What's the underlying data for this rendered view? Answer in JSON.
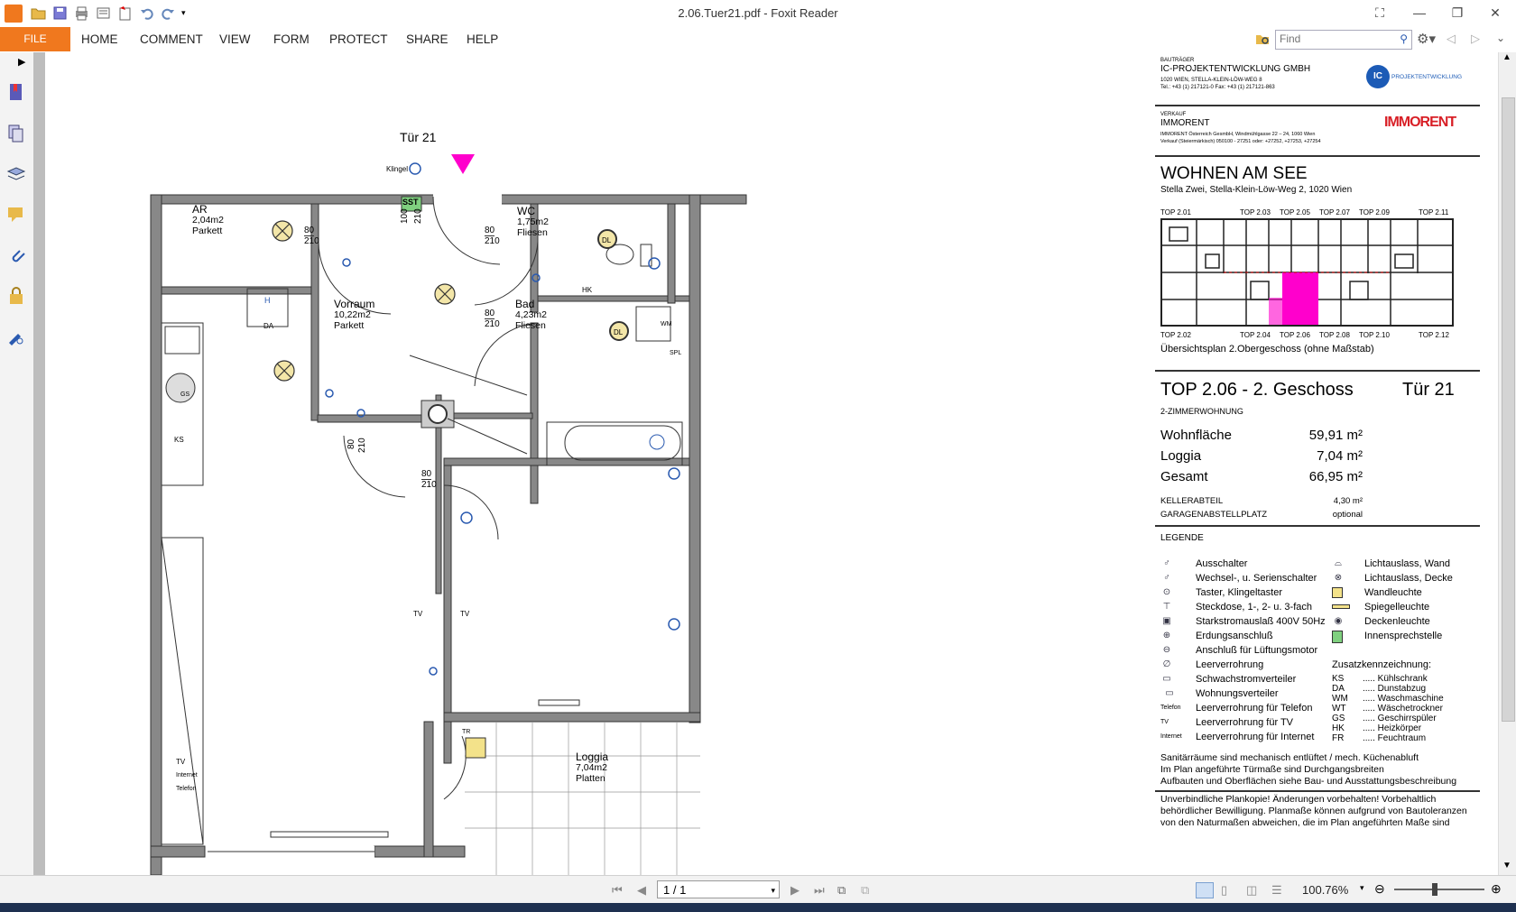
{
  "app": {
    "window_title": "2.06.Tuer21.pdf - Foxit Reader",
    "menu": {
      "file": "FILE",
      "items": [
        "HOME",
        "COMMENT",
        "VIEW",
        "FORM",
        "PROTECT",
        "SHARE",
        "HELP"
      ]
    },
    "find_placeholder": "Find",
    "page_field": "1 / 1",
    "zoom": "100.76%",
    "colors": {
      "file_tab": "#f0781e",
      "highlight": "#ff00cc"
    }
  },
  "plan": {
    "door_label": "Tür 21",
    "bell": "Klingel",
    "rooms": [
      {
        "name": "AR",
        "area": "2,04m2",
        "floor": "Parkett"
      },
      {
        "name": "WC",
        "area": "1,75m2",
        "floor": "Fliesen"
      },
      {
        "name": "Vorraum",
        "area": "10,22m2",
        "floor": "Parkett"
      },
      {
        "name": "Bad",
        "area": "4,23m2",
        "floor": "Fliesen"
      },
      {
        "name": "Loggia",
        "area": "7,04m2",
        "floor": "Platten"
      }
    ],
    "door_sizes": [
      "80",
      "210",
      "100",
      "210"
    ],
    "fixtures": {
      "sst": "SST",
      "dl": "DL",
      "h": "H",
      "da": "DA",
      "ks": "KS",
      "hk": "HK",
      "wm": "WM",
      "sp": "SPL",
      "tr": "TR",
      "gs": "GS"
    },
    "outlets": {
      "tv": "TV",
      "internet": "Internet",
      "telefon": "Telefon"
    }
  },
  "sheet": {
    "developer_label": "BAUTRÄGER",
    "developer": "IC-PROJEKTENTWICKLUNG GMBH",
    "developer_address": "1020 WIEN, STELLA-KLEIN-LÖW-WEG 8",
    "developer_phone": "Tel.: +43 (1) 217121-0  Fax: +43 (1) 217121-863",
    "developer_logo": "IC",
    "developer_logo_text": "PROJEKTENTWICKLUNG",
    "sales_label": "VERKAUF",
    "sales": "IMMORENT",
    "sales_address": "IMMORENT Österreich GesmbH, Windmühlgasse 22 – 24, 1060 Wien",
    "sales_phone": "Verkauf (Steiermärkisch) 050100 - 27251 oder: +27252, +27253, +27254",
    "sales_logo": "IMMORENT",
    "project": "WOHNEN AM SEE",
    "project_address": "Stella Zwei, Stella-Klein-Löw-Weg 2, 1020 Wien",
    "overview_top": [
      "TOP 2.01",
      "TOP 2.03",
      "TOP 2.05",
      "TOP 2.07",
      "TOP 2.09",
      "TOP 2.11"
    ],
    "overview_bottom": [
      "TOP 2.02",
      "TOP 2.04",
      "TOP 2.06",
      "TOP 2.08",
      "TOP 2.10",
      "TOP 2.12"
    ],
    "overview_caption": "Übersichtsplan 2.Obergeschoss (ohne Maßstab)",
    "unit_title": "TOP 2.06 - 2. Geschoss",
    "unit_door": "Tür 21",
    "unit_type": "2-ZIMMERWOHNUNG",
    "areas": [
      {
        "label": "Wohnfläche",
        "value": "59,91 m²"
      },
      {
        "label": "Loggia",
        "value": "7,04 m²"
      },
      {
        "label": "Gesamt",
        "value": "66,95 m²"
      }
    ],
    "extras": [
      {
        "label": "KELLERABTEIL",
        "value": "4,30 m²"
      },
      {
        "label": "GARAGENABSTELLPLATZ",
        "value": "optional"
      }
    ],
    "legend_title": "LEGENDE",
    "legend_left": [
      "Ausschalter",
      "Wechsel-, u. Serienschalter",
      "Taster, Klingeltaster",
      "Steckdose, 1-, 2- u. 3-fach",
      "Starkstromauslaß 400V 50Hz",
      "Erdungsanschluß",
      "Anschluß für Lüftungsmotor",
      "Leerverrohrung",
      "Schwachstromverteiler",
      "Wohnungsverteiler",
      "Leerverrohrung für Telefon",
      "Leerverrohrung für TV",
      "Leerverrohrung für Internet"
    ],
    "legend_left_prefix": [
      "",
      "",
      "",
      "",
      "",
      "",
      "",
      "",
      "",
      "",
      "Telefon",
      "TV",
      "Internet"
    ],
    "legend_right": [
      "Lichtauslass, Wand",
      "Lichtauslass, Decke",
      "Wandleuchte",
      "Spiegelleuchte",
      "Deckenleuchte",
      "Innensprechstelle"
    ],
    "extra_marks_title": "Zusatzkennzeichnung:",
    "extra_marks": [
      {
        "code": "KS",
        "label": "Kühlschrank"
      },
      {
        "code": "DA",
        "label": "Dunstabzug"
      },
      {
        "code": "WM",
        "label": "Waschmaschine"
      },
      {
        "code": "WT",
        "label": "Wäschetrockner"
      },
      {
        "code": "GS",
        "label": "Geschirrspüler"
      },
      {
        "code": "HK",
        "label": "Heizkörper"
      },
      {
        "code": "FR",
        "label": "Feuchtraum"
      }
    ],
    "notes": [
      "Sanitärräume sind mechanisch entlüftet / mech. Küchenabluft",
      "Im Plan angeführte Türmaße sind Durchgangsbreiten",
      "Aufbauten und Oberflächen siehe Bau- und Ausstattungsbeschreibung"
    ],
    "disclaimer": [
      "Unverbindliche Plankopie! Änderungen vorbehalten! Vorbehaltlich",
      "behördlicher Bewilligung. Planmaße können aufgrund von Bautoleranzen",
      "von den Naturmaßen abweichen, die im Plan angeführten Maße sind"
    ]
  }
}
